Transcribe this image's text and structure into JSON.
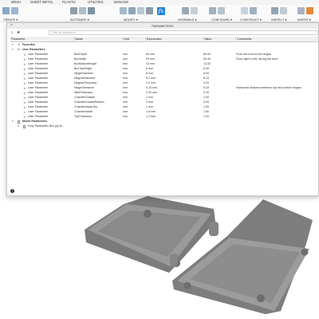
{
  "ribbon": {
    "tabs": [
      "MESH",
      "SHEET METAL",
      "PLASTIC",
      "UTILITIES",
      "MANAGE"
    ],
    "groups": [
      "CREATE ▾",
      "AUTOMATE ▾",
      "MODIFY ▾",
      "ASSEMBLE ▾",
      "CONFIGURE ▾",
      "CONSTRUCT ▾",
      "INSPECT ▾",
      "INSERT ▾"
    ],
    "fx_glyph": "fx"
  },
  "dialog": {
    "title": "PARAMETERS",
    "close_glyph": "×",
    "search_icon": "⌕",
    "favorites_star": "★",
    "filter_placeholder": "Filter all parameters",
    "info_glyph": "i"
  },
  "columns": [
    "Parameter",
    "Name",
    "Unit",
    "Expression",
    "Value",
    "Comments"
  ],
  "sections": {
    "favorites": "Favorites",
    "user": "User Parameters",
    "model": "Model Parameters",
    "model_item": "Fully Parametric Box pg.W..."
  },
  "rows": [
    {
      "parameter": "User Parameter",
      "name": "BoxDepth",
      "unit": "mm",
      "expression": "60 mm",
      "value": "60.00",
      "comment": "From the front to the hinges"
    },
    {
      "parameter": "User Parameter",
      "name": "BoxWidth",
      "unit": "mm",
      "expression": "90 mm",
      "value": "90.00",
      "comment": "From right to left, facing the front"
    },
    {
      "parameter": "User Parameter",
      "name": "BoxBottomHeight",
      "unit": "mm",
      "expression": "13 mm",
      "value": "13.00",
      "comment": ""
    },
    {
      "parameter": "User Parameter",
      "name": "BoxTopHeight",
      "unit": "mm",
      "expression": "6 mm",
      "value": "6.00",
      "comment": ""
    },
    {
      "parameter": "User Parameter",
      "name": "HingeDiameter",
      "unit": "mm",
      "expression": "8 mm",
      "value": "8.00",
      "comment": ""
    },
    {
      "parameter": "User Parameter",
      "name": "MagnetDiameter",
      "unit": "mm",
      "expression": "8.1 mm",
      "value": "8.10",
      "comment": ""
    },
    {
      "parameter": "User Parameter",
      "name": "MagnetThickness",
      "unit": "mm",
      "expression": "3.2 mm",
      "value": "3.20",
      "comment": ""
    },
    {
      "parameter": "User Parameter",
      "name": "HingeTolerance",
      "unit": "mm",
      "expression": "0.15 mm",
      "value": "0.15",
      "comment": "Horizontal distance between top and bottom hinges"
    },
    {
      "parameter": "User Parameter",
      "name": "WallThickness",
      "unit": "mm",
      "expression": "2.49 mm",
      "value": "2.49",
      "comment": ""
    },
    {
      "parameter": "User Parameter",
      "name": "ChamferOutside",
      "unit": "mm",
      "expression": "1 mm",
      "value": "1.00",
      "comment": ""
    },
    {
      "parameter": "User Parameter",
      "name": "ChamferOutsideBottom",
      "unit": "mm",
      "expression": "3 mm",
      "value": "3.00",
      "comment": ""
    },
    {
      "parameter": "User Parameter",
      "name": "ChamferInsideTop",
      "unit": "mm",
      "expression": "1 mm",
      "value": "1.00",
      "comment": ""
    },
    {
      "parameter": "User Parameter",
      "name": "ChamferInside",
      "unit": "mm",
      "expression": "1.6 mm",
      "value": "1.60",
      "comment": ""
    },
    {
      "parameter": "User Parameter",
      "name": "TopThickness",
      "unit": "mm",
      "expression": "1.2 mm",
      "value": "1.20",
      "comment": ""
    }
  ]
}
